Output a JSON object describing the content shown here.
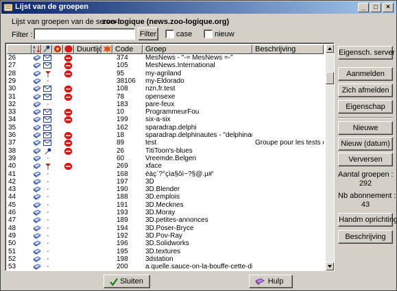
{
  "window": {
    "title": "Lijst van de groepen"
  },
  "header": {
    "server_label": "Lijst van groepen van de server :",
    "server_name": "zoo-logique (news.zoo-logique.org)",
    "filter_label": "Filter :",
    "filter_value": "",
    "filter_button": "Filter",
    "case_label": "case",
    "new_label": "nieuw"
  },
  "columns": [
    "Duurtijd",
    "Code",
    "Groep",
    "Beschrijving"
  ],
  "rows": [
    {
      "num": "26",
      "mail": true,
      "flag": "",
      "stop": true,
      "code": "374",
      "group": "MesNews - \"-= MesNews =-\"",
      "desc": ""
    },
    {
      "num": "27",
      "mail": true,
      "flag": "",
      "stop": true,
      "code": "105",
      "group": "MesNews.International",
      "desc": ""
    },
    {
      "num": "28",
      "mail": false,
      "flag": "red",
      "stop": true,
      "code": "95",
      "group": "my-agriland",
      "desc": ""
    },
    {
      "num": "29",
      "mail": false,
      "flag": "dash",
      "stop": false,
      "code": "38106",
      "group": "my-Eldorado",
      "desc": ""
    },
    {
      "num": "30",
      "mail": true,
      "flag": "",
      "stop": true,
      "code": "108",
      "group": "nzn.fr.test",
      "desc": ""
    },
    {
      "num": "31",
      "mail": true,
      "flag": "",
      "stop": true,
      "code": "78",
      "group": "opensexe",
      "desc": ""
    },
    {
      "num": "32",
      "mail": false,
      "flag": "dash",
      "stop": false,
      "code": "183",
      "group": "pare-feux",
      "desc": ""
    },
    {
      "num": "33",
      "mail": true,
      "flag": "",
      "stop": true,
      "code": "10",
      "group": "ProgrammeurFou",
      "desc": ""
    },
    {
      "num": "34",
      "mail": true,
      "flag": "",
      "stop": true,
      "code": "199",
      "group": "six-a-six",
      "desc": ""
    },
    {
      "num": "35",
      "mail": true,
      "flag": "",
      "stop": false,
      "code": "162",
      "group": "sparadrap.delphi",
      "desc": ""
    },
    {
      "num": "36",
      "mail": true,
      "flag": "",
      "stop": true,
      "code": "18",
      "group": "sparadrap.delphinautes - \"delphinautes\"",
      "desc": ""
    },
    {
      "num": "37",
      "mail": true,
      "flag": "",
      "stop": true,
      "code": "89",
      "group": "test",
      "desc": "Groupe pour les tests de p..."
    },
    {
      "num": "38",
      "mail": false,
      "flag": "pin",
      "stop": true,
      "code": "26",
      "group": "TitiToon's-blues",
      "desc": ""
    },
    {
      "num": "39",
      "mail": false,
      "flag": "dash",
      "stop": false,
      "code": "60",
      "group": "Vreemde.Belgen",
      "desc": ""
    },
    {
      "num": "40",
      "mail": false,
      "flag": "red",
      "stop": true,
      "code": "269",
      "group": "xface",
      "desc": ""
    },
    {
      "num": "41",
      "mail": false,
      "flag": "dash",
      "stop": false,
      "code": "168",
      "group": "éàç`?°çìa§ôì~?§@.µ#'",
      "desc": ""
    },
    {
      "num": "42",
      "mail": false,
      "flag": "dash",
      "stop": false,
      "code": "197",
      "group": "3D",
      "desc": ""
    },
    {
      "num": "43",
      "mail": false,
      "flag": "dash",
      "stop": false,
      "code": "190",
      "group": "3D.Blender",
      "desc": ""
    },
    {
      "num": "44",
      "mail": false,
      "flag": "dash",
      "stop": false,
      "code": "188",
      "group": "3D.emplois",
      "desc": ""
    },
    {
      "num": "45",
      "mail": false,
      "flag": "dash",
      "stop": false,
      "code": "191",
      "group": "3D.Mecknes",
      "desc": ""
    },
    {
      "num": "46",
      "mail": false,
      "flag": "dash",
      "stop": false,
      "code": "193",
      "group": "3D.Moray",
      "desc": ""
    },
    {
      "num": "47",
      "mail": false,
      "flag": "dash",
      "stop": false,
      "code": "189",
      "group": "3D.petites-annonces",
      "desc": ""
    },
    {
      "num": "48",
      "mail": false,
      "flag": "dash",
      "stop": false,
      "code": "194",
      "group": "3D.Poser-Bryce",
      "desc": ""
    },
    {
      "num": "49",
      "mail": false,
      "flag": "dash",
      "stop": false,
      "code": "192",
      "group": "3D.Pov-Ray",
      "desc": ""
    },
    {
      "num": "50",
      "mail": false,
      "flag": "dash",
      "stop": false,
      "code": "196",
      "group": "3D.Solidworks",
      "desc": ""
    },
    {
      "num": "51",
      "mail": false,
      "flag": "dash",
      "stop": false,
      "code": "195",
      "group": "3D.textures",
      "desc": ""
    },
    {
      "num": "52",
      "mail": false,
      "flag": "dash",
      "stop": false,
      "code": "198",
      "group": "3dstation",
      "desc": ""
    },
    {
      "num": "53",
      "mail": false,
      "flag": "dash",
      "stop": false,
      "code": "200",
      "group": "a.quelle.sauce-on-la-bouffe-cette-dinde",
      "desc": ""
    }
  ],
  "side": {
    "servers": "Eigensch. server",
    "subscribe": "Aanmelden",
    "unsubscribe": "Zich afmelden",
    "properties": "Eigenschap",
    "new": "Nieuwe",
    "new_date": "Nieuw (datum)",
    "refresh": "Verversen",
    "group_count_label": "Aantal groepen :",
    "group_count": "292",
    "sub_count_label": "Nb abonnement :",
    "sub_count": "43",
    "manual": "Handm oprichting",
    "description": "Beschrijving"
  },
  "footer": {
    "close": "Sluiten",
    "help": "Hulp"
  },
  "colors": {
    "title_start": "#0a246a",
    "title_end": "#a6caf0",
    "stop_red": "#d81818",
    "mail_blue": "#1e3c8c"
  }
}
